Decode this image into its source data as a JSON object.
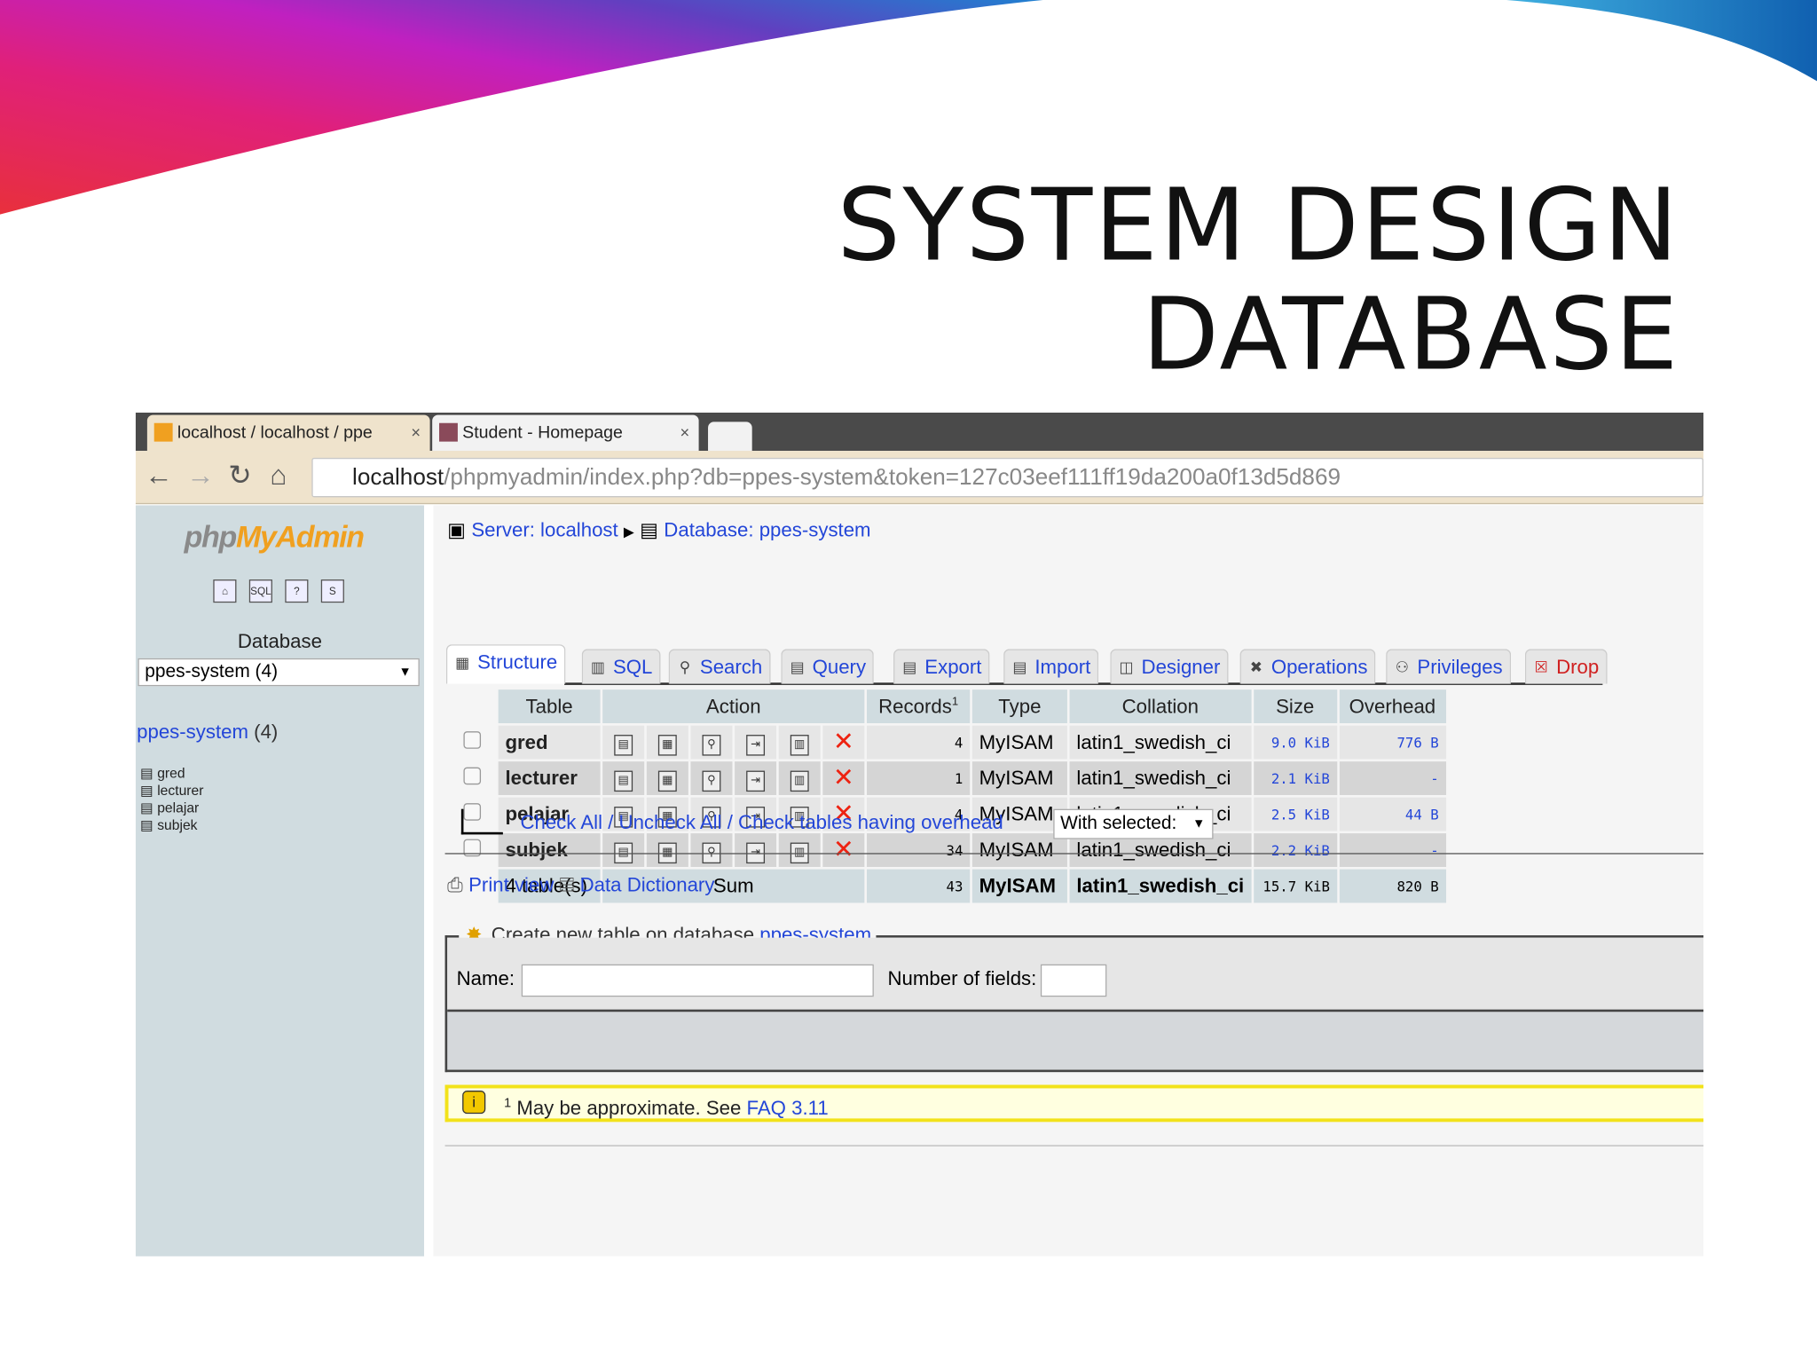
{
  "slide": {
    "title_line1": "SYSTEM DESIGN",
    "title_line2": "DATABASE"
  },
  "browser": {
    "tabs": [
      {
        "label": "localhost / localhost / ppe",
        "close": "×",
        "icon": "pma-icon"
      },
      {
        "label": "Student - Homepage",
        "close": "×",
        "icon": "m-icon"
      }
    ],
    "url_host": "localhost",
    "url_path": "/phpmyadmin/index.php?db=ppes-system&token=127c03eef111ff19da200a0f13d5d869"
  },
  "sidebar": {
    "logo_php": "php",
    "logo_myadmin": "MyAdmin",
    "db_label": "Database",
    "db_select": "ppes-system (4)",
    "db_link": "ppes-system",
    "db_count": "(4)",
    "tables": [
      "gred",
      "lecturer",
      "pelajar",
      "subjek"
    ]
  },
  "breadcrumb": {
    "server": "Server: localhost",
    "database": "Database: ppes-system"
  },
  "tabs": [
    "Structure",
    "SQL",
    "Search",
    "Query",
    "Export",
    "Import",
    "Designer",
    "Operations",
    "Privileges",
    "Drop"
  ],
  "table": {
    "headers": [
      "Table",
      "Action",
      "Records",
      "Type",
      "Collation",
      "Size",
      "Overhead"
    ],
    "records_sup": "1",
    "rows": [
      {
        "name": "gred",
        "records": "4",
        "type": "MyISAM",
        "collation": "latin1_swedish_ci",
        "size": "9.0 KiB",
        "overhead": "776 B"
      },
      {
        "name": "lecturer",
        "records": "1",
        "type": "MyISAM",
        "collation": "latin1_swedish_ci",
        "size": "2.1 KiB",
        "overhead": "-"
      },
      {
        "name": "pelajar",
        "records": "4",
        "type": "MyISAM",
        "collation": "latin1_swedish_ci",
        "size": "2.5 KiB",
        "overhead": "44 B"
      },
      {
        "name": "subjek",
        "records": "34",
        "type": "MyISAM",
        "collation": "latin1_swedish_ci",
        "size": "2.2 KiB",
        "overhead": "-"
      }
    ],
    "sum": {
      "name": "4 table(s)",
      "label": "Sum",
      "records": "43",
      "type": "MyISAM",
      "collation": "latin1_swedish_ci",
      "size": "15.7 KiB",
      "overhead": "820 B"
    }
  },
  "bulk": {
    "check_all": "Check All",
    "uncheck_all": "Uncheck All",
    "check_overhead": "Check tables having overhead",
    "sep": " / ",
    "with_selected": "With selected:"
  },
  "links": {
    "print_view": "Print view",
    "data_dictionary": "Data Dictionary"
  },
  "create": {
    "legend": "Create new table on database ",
    "db": "ppes-system",
    "name_label": "Name:",
    "fields_label": "Number of fields:",
    "name_value": "",
    "fields_value": ""
  },
  "note": {
    "sup": "1",
    "text": " May be approximate. See ",
    "link": "FAQ 3.11"
  }
}
